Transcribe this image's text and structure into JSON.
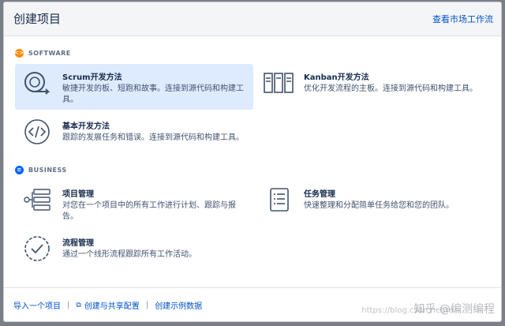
{
  "header": {
    "title": "创建项目",
    "market_link": "查看市场工作流"
  },
  "sections": {
    "software": {
      "label": "SOFTWARE",
      "color": "#ff8b00"
    },
    "business": {
      "label": "BUSINESS",
      "color": "#0065ff"
    }
  },
  "tiles": {
    "scrum": {
      "name": "Scrum开发方法",
      "desc": "敏捷开发的板、短跑和故事。连接到源代码和构建工具。",
      "icon": "cycle-icon"
    },
    "kanban": {
      "name": "Kanban开发方法",
      "desc": "优化开发流程的主板。连接到源代码和构建工具。",
      "icon": "board-columns-icon"
    },
    "basic": {
      "name": "基本开发方法",
      "desc": "跟踪的发展任务和错误。连接到源代码和构建工具。",
      "icon": "code-icon"
    },
    "project_mgmt": {
      "name": "项目管理",
      "desc": "对您在一个项目中的所有工作进行计划、跟踪与报告。",
      "icon": "hierarchy-icon"
    },
    "task_mgmt": {
      "name": "任务管理",
      "desc": "快速整理和分配简单任务给您和您的团队。",
      "icon": "task-list-icon"
    },
    "process_mgmt": {
      "name": "流程管理",
      "desc": "通过一个线形流程跟踪所有工作活动。",
      "icon": "check-circle-icon"
    }
  },
  "footer": {
    "import_link": "导入一个项目",
    "share_link": "创建与共享配置",
    "sample_link": "创建示例数据",
    "separator": "|"
  },
  "watermark": {
    "text": "知乎 @编测编程",
    "url": "https://blog.csdn.net/m"
  }
}
